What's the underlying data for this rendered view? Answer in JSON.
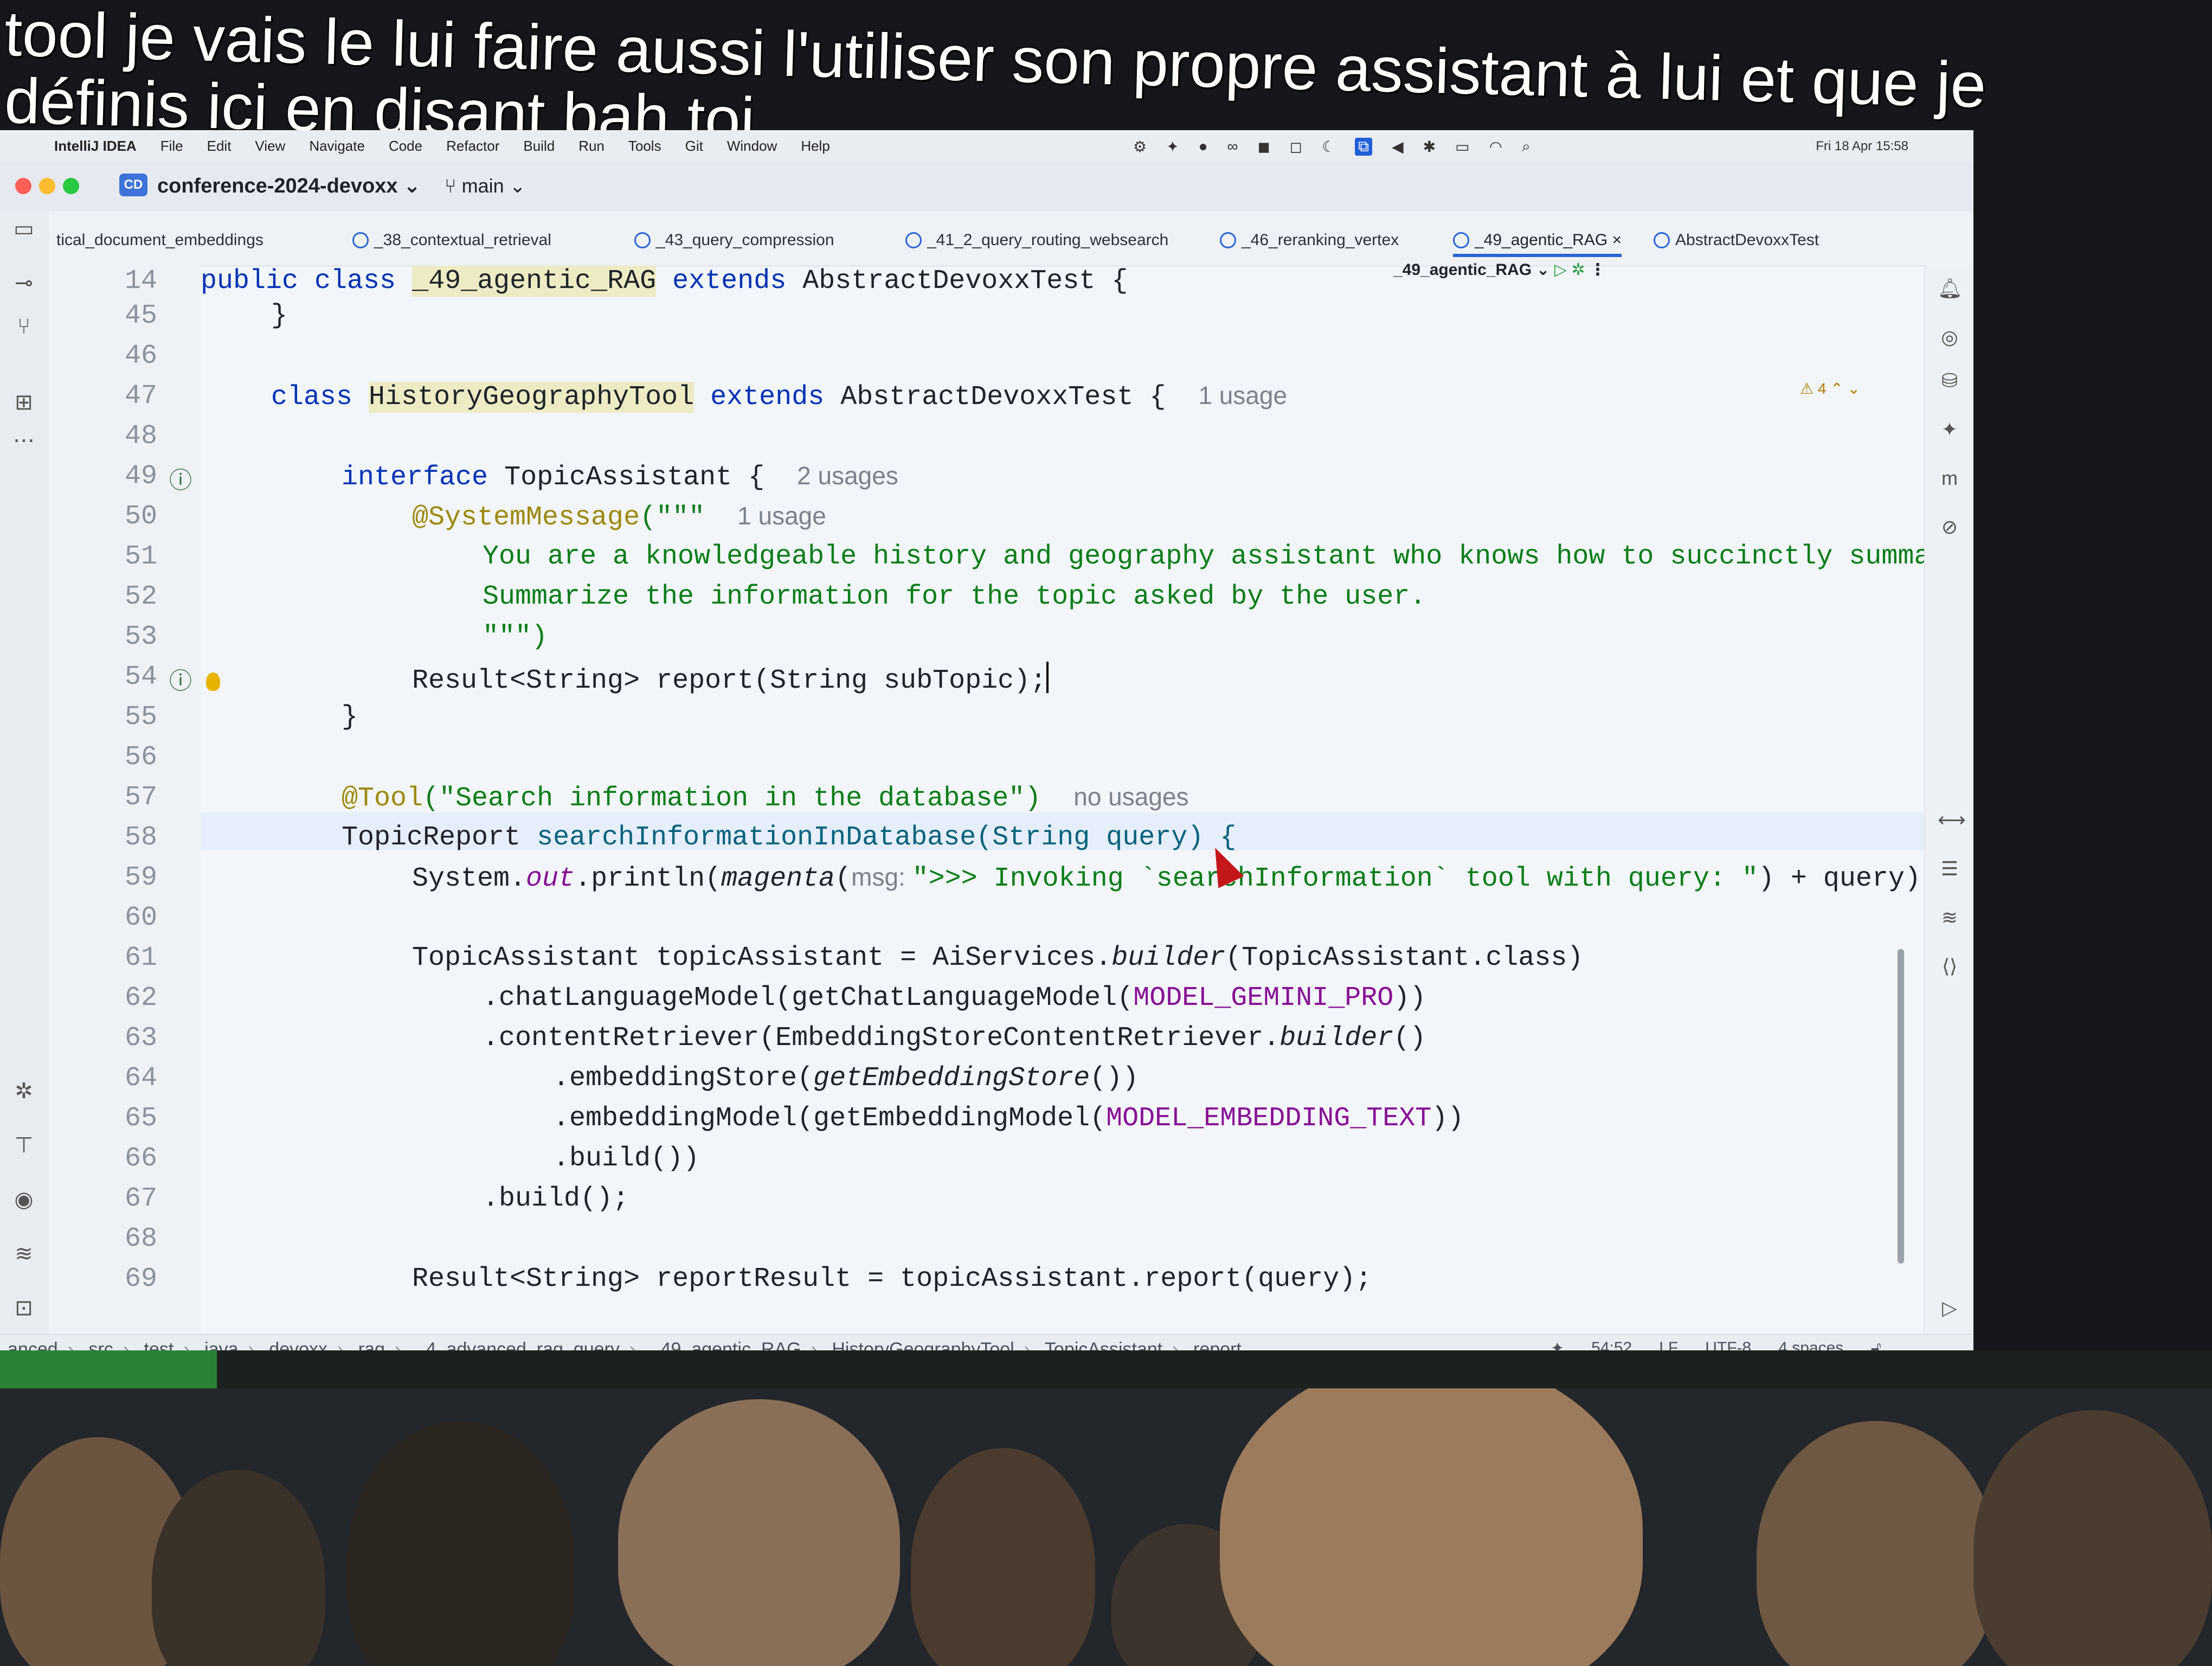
{
  "subtitle": {
    "line1": "tool je vais le lui faire aussi l'utiliser son propre assistant à lui et que je",
    "line2": "définis ici en disant bah toi"
  },
  "mac_menu": {
    "items": [
      "IntelliJ IDEA",
      "File",
      "Edit",
      "View",
      "Navigate",
      "Code",
      "Refactor",
      "Build",
      "Run",
      "Tools",
      "Git",
      "Window",
      "Help"
    ],
    "clock": "Fri 18 Apr 15:58"
  },
  "titlebar": {
    "project_badge": "CD",
    "project_name": "conference-2024-devoxx",
    "branch": "main",
    "run_config": "_49_agentic_RAG"
  },
  "tabs": [
    "tical_document_embeddings",
    "_38_contextual_retrieval",
    "_43_query_compression",
    "_41_2_query_routing_websearch",
    "_46_reranking_vertex",
    "_49_agentic_RAG",
    "AbstractDevoxxTest"
  ],
  "editor": {
    "line_numbers": [
      "14",
      "45",
      "46",
      "47",
      "48",
      "49",
      "50",
      "51",
      "52",
      "53",
      "54",
      "55",
      "56",
      "57",
      "58",
      "59",
      "60",
      "61",
      "62",
      "63",
      "64",
      "65",
      "66",
      "67",
      "68",
      "69"
    ],
    "sticky": {
      "kw": "public class",
      "cls": "_49_agentic_RAG",
      "kw2": "extends",
      "rest": "AbstractDevoxxTest {"
    },
    "l45": "}",
    "l47_kw": "class",
    "l47_cls": "HistoryGeographyTool",
    "l47_kw2": "extends",
    "l47_rest": "AbstractDevoxxTest {",
    "l47_hint": "1 usage",
    "l49_kw": "interface",
    "l49_rest": "TopicAssistant {",
    "l49_hint": "2 usages",
    "l50_ann": "@SystemMessage",
    "l50_rest": "(\"\"\"",
    "l50_hint": "1 usage",
    "l51": "You are a knowledgeable history and geography assistant who knows how to succinctly summarize",
    "l52": "Summarize the information for the topic asked by the user.",
    "l53": "\"\"\")",
    "l54": "Result<String> report(String subTopic);",
    "l55": "}",
    "l57_ann": "@Tool",
    "l57_str": "(\"Search information in the database\")",
    "l57_hint": "no usages",
    "l58_type": "TopicReport",
    "l58_rest": "searchInformationInDatabase(String query) {",
    "l59_a": "System.",
    "l59_out": "out",
    "l59_b": ".println(",
    "l59_mag": "magenta",
    "l59_c": "(",
    "l59_msg": "msg: ",
    "l59_str": "\">>> Invoking `searchInformation` tool with query: \"",
    "l59_d": ") + query);",
    "l61_a": "TopicAssistant topicAssistant = AiServices.",
    "l61_b": "builder",
    "l61_c": "(TopicAssistant.class)",
    "l62_a": ".chatLanguageModel(getChatLanguageModel(",
    "l62_b": "MODEL_GEMINI_PRO",
    "l62_c": "))",
    "l63_a": ".contentRetriever(EmbeddingStoreContentRetriever.",
    "l63_b": "builder",
    "l63_c": "()",
    "l64_a": ".embeddingStore(",
    "l64_b": "getEmbeddingStore",
    "l64_c": "())",
    "l65_a": ".embeddingModel(getEmbeddingModel(",
    "l65_b": "MODEL_EMBEDDING_TEXT",
    "l65_c": "))",
    "l66": ".build())",
    "l67": ".build();",
    "l69": "Result<String> reportResult = topicAssistant.report(query);",
    "warnings": "4"
  },
  "breadcrumb": {
    "items": [
      "anced",
      "src",
      "test",
      "java",
      "devoxx",
      "rag",
      "_4_advanced_rag_query",
      "_49_agentic_RAG",
      "HistoryGeographyTool",
      "TopicAssistant",
      "report"
    ],
    "position": "54:52",
    "line_sep": "LF",
    "encoding": "UTF-8",
    "indent": "4 spaces"
  }
}
